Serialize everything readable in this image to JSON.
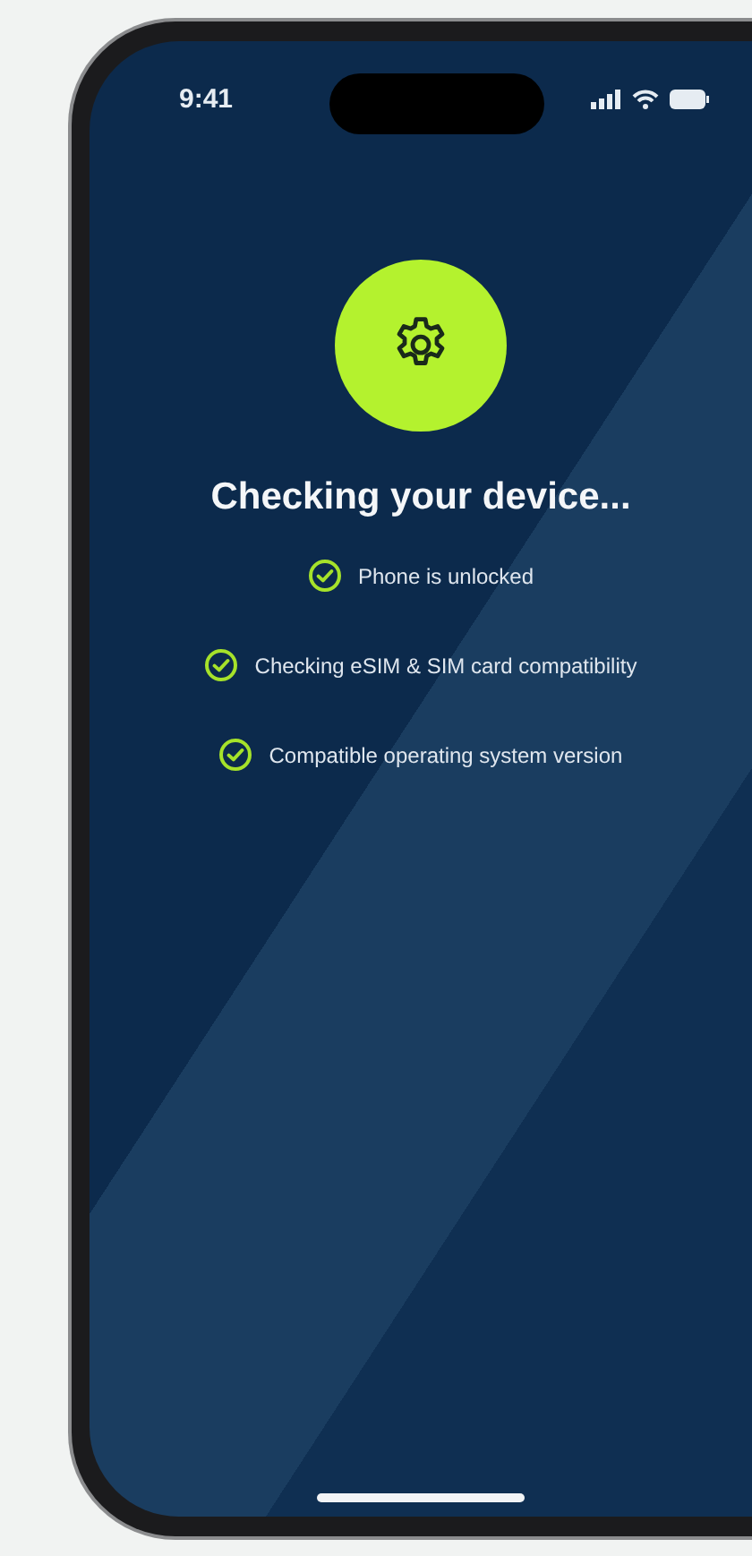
{
  "status_bar": {
    "time": "9:41"
  },
  "screen": {
    "title": "Checking your device...",
    "checks": [
      {
        "label": "Phone is unlocked",
        "checked": true
      },
      {
        "label": "Checking eSIM & SIM card compatibility",
        "checked": true
      },
      {
        "label": "Compatible operating system version",
        "checked": true
      }
    ]
  }
}
